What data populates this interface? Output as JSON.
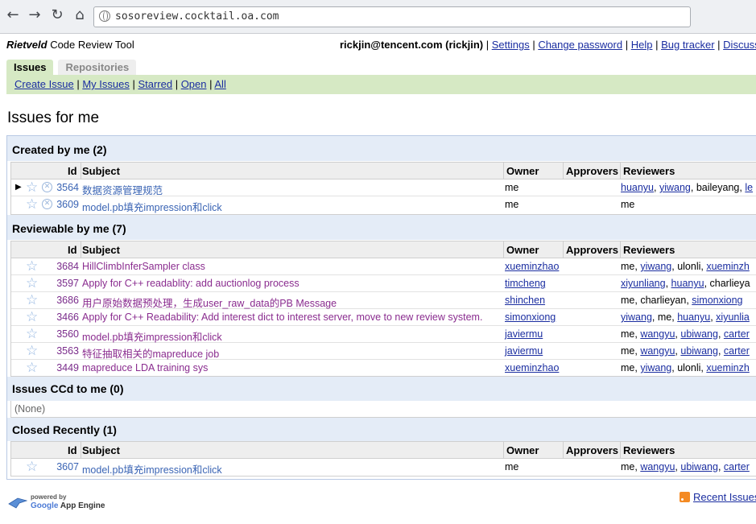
{
  "browser": {
    "url": "sosoreview.cocktail.oa.com",
    "icons": [
      "back-icon",
      "forward-icon",
      "reload-icon",
      "home-icon",
      "globe-icon"
    ]
  },
  "header": {
    "app_title_italic": "Rietveld",
    "app_title_rest": " Code Review Tool",
    "user": "rickjin@tencent.com (rickjin)",
    "links": [
      "Settings",
      "Change password",
      "Help",
      "Bug tracker",
      "Discuss"
    ]
  },
  "tabs": [
    {
      "label": "Issues",
      "active": true
    },
    {
      "label": "Repositories",
      "active": false
    }
  ],
  "subnav": [
    "Create Issue",
    "My Issues",
    "Starred",
    "Open",
    "All"
  ],
  "page_title": "Issues for me",
  "columns": {
    "id": "Id",
    "subject": "Subject",
    "owner": "Owner",
    "approvers": "Approvers",
    "reviewers": "Reviewers"
  },
  "sections": {
    "created": {
      "title": "Created by me (2)",
      "rows": [
        {
          "id": "3564",
          "subject": "数据资源管理规范",
          "owner": "me",
          "reviewers": [
            {
              "t": "huanyu",
              "l": true
            },
            {
              "t": "yiwang",
              "l": true
            },
            {
              "t": "baileyang",
              "l": false
            },
            {
              "t": "le",
              "l": true
            }
          ]
        },
        {
          "id": "3609",
          "subject": "model.pb填充impression和click",
          "owner": "me",
          "reviewers": [
            {
              "t": "me",
              "l": false
            }
          ]
        }
      ]
    },
    "reviewable": {
      "title": "Reviewable by me (7)",
      "rows": [
        {
          "id": "3684",
          "subject": "HillClimbInferSampler class",
          "owner": "xueminzhao",
          "reviewers": [
            {
              "t": "me",
              "l": false
            },
            {
              "t": "yiwang",
              "l": true
            },
            {
              "t": "ulonli",
              "l": false
            },
            {
              "t": "xueminzh",
              "l": true
            }
          ]
        },
        {
          "id": "3597",
          "subject": "Apply for C++ readablity: add auctionlog process",
          "owner": "timcheng",
          "reviewers": [
            {
              "t": "xiyunliang",
              "l": true
            },
            {
              "t": "huanyu",
              "l": true
            },
            {
              "t": "charlieya",
              "l": false
            }
          ]
        },
        {
          "id": "3686",
          "subject": "用户原始数据预处理，生成user_raw_data的PB Message",
          "owner": "shinchen",
          "reviewers": [
            {
              "t": "me",
              "l": false
            },
            {
              "t": "charlieyan",
              "l": false
            },
            {
              "t": "simonxiong",
              "l": true
            }
          ]
        },
        {
          "id": "3466",
          "subject": "Apply for C++ Readability: Add interest dict to interest server, move to new review system.",
          "owner": "simonxiong",
          "reviewers": [
            {
              "t": "yiwang",
              "l": true
            },
            {
              "t": "me",
              "l": false
            },
            {
              "t": "huanyu",
              "l": true
            },
            {
              "t": "xiyunlia",
              "l": true
            }
          ]
        },
        {
          "id": "3560",
          "subject": "model.pb填充impression和click",
          "owner": "javiermu",
          "reviewers": [
            {
              "t": "me",
              "l": false
            },
            {
              "t": "wangyu",
              "l": true
            },
            {
              "t": "ubiwang",
              "l": true
            },
            {
              "t": "carter",
              "l": true
            }
          ]
        },
        {
          "id": "3563",
          "subject": "特征抽取相关的mapreduce job",
          "owner": "javiermu",
          "reviewers": [
            {
              "t": "me",
              "l": false
            },
            {
              "t": "wangyu",
              "l": true
            },
            {
              "t": "ubiwang",
              "l": true
            },
            {
              "t": "carter",
              "l": true
            }
          ]
        },
        {
          "id": "3449",
          "subject": "mapreduce LDA training sys",
          "owner": "xueminzhao",
          "reviewers": [
            {
              "t": "me",
              "l": false
            },
            {
              "t": "yiwang",
              "l": true
            },
            {
              "t": "ulonli",
              "l": false
            },
            {
              "t": "xueminzh",
              "l": true
            }
          ]
        }
      ]
    },
    "ccd": {
      "title": "Issues CCd to me (0)",
      "empty": "(None)"
    },
    "closed": {
      "title": "Closed Recently (1)",
      "rows": [
        {
          "id": "3607",
          "subject": "model.pb填充impression和click",
          "owner": "me",
          "reviewers": [
            {
              "t": "me",
              "l": false
            },
            {
              "t": "wangyu",
              "l": true
            },
            {
              "t": "ubiwang",
              "l": true
            },
            {
              "t": "carter",
              "l": true
            }
          ]
        }
      ]
    }
  },
  "footer": {
    "powered_by": "powered by",
    "engine_google": "Google",
    "engine_rest": " App Engine",
    "recent": "Recent Issues"
  },
  "colors": {
    "accent_green": "#d6e9c4",
    "section_blue": "#e4ecf7",
    "link": "#1a2da0",
    "subject_purple": "#8a2c8f",
    "subject_blue": "#3a64b4"
  }
}
